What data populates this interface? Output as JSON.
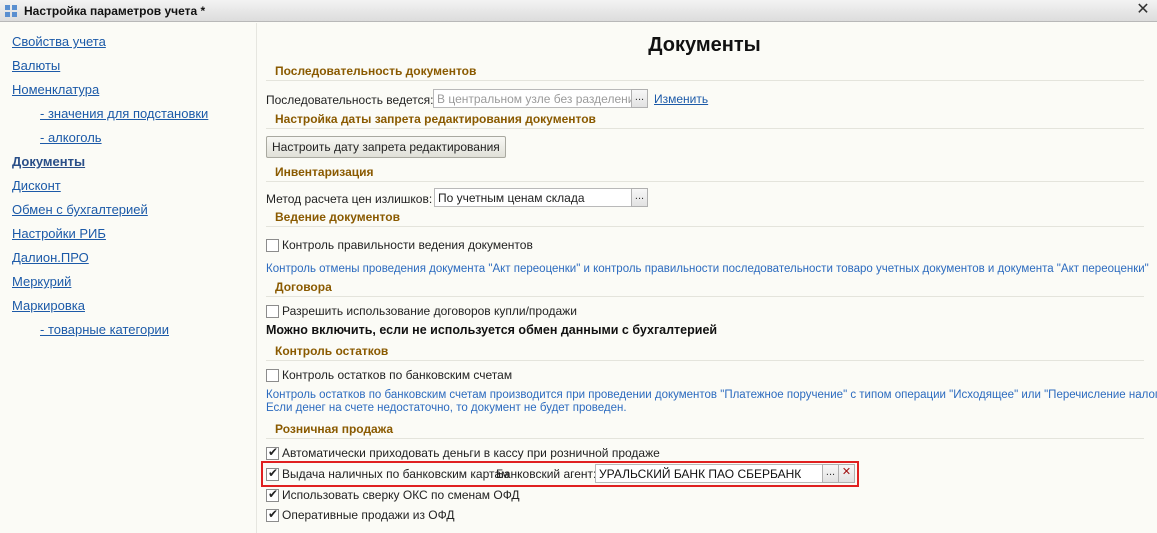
{
  "window": {
    "title": "Настройка параметров учета *",
    "close_glyph": "✕"
  },
  "nav": {
    "items": [
      {
        "label": "Свойства учета"
      },
      {
        "label": "Валюты"
      },
      {
        "label": "Номенклатура"
      },
      {
        "label": "- значения для подстановки"
      },
      {
        "label": "- алкоголь"
      },
      {
        "label": "Документы"
      },
      {
        "label": "Дисконт"
      },
      {
        "label": "Обмен с бухгалтерией"
      },
      {
        "label": "Настройки РИБ"
      },
      {
        "label": "Далион.ПРО"
      },
      {
        "label": "Меркурий"
      },
      {
        "label": "Маркировка"
      },
      {
        "label": "- товарные категории"
      }
    ],
    "active_index": 5
  },
  "main": {
    "title": "Документы",
    "sections": {
      "sequence": {
        "header": "Последовательность документов",
        "label": "Последовательность ведется:",
        "field_value": "В центральном узле без разделения по",
        "select_glyph": "...",
        "change_link": "Изменить"
      },
      "lock_date": {
        "header": "Настройка даты запрета редактирования документов",
        "button": "Настроить дату запрета редактирования"
      },
      "inventory": {
        "header": "Инвентаризация",
        "label": "Метод расчета цен излишков:",
        "field_value": "По учетным ценам склада",
        "select_glyph": "..."
      },
      "doc_keeping": {
        "header": "Ведение документов",
        "check_label": "Контроль правильности ведения документов",
        "checked": false,
        "note": "Контроль отмены проведения документа \"Акт переоценки\" и контроль правильности последовательности товаро учетных документов и документа \"Акт переоценки\""
      },
      "contracts": {
        "header": "Договора",
        "check_label": "Разрешить использование договоров купли/продажи",
        "checked": false,
        "note": "Можно включить, если не используется обмен данными с бухгалтерией"
      },
      "balance": {
        "header": "Контроль остатков",
        "check_label": "Контроль остатков по банковским счетам",
        "checked": false,
        "note_line1": "Контроль остатков по банковским счетам производится при проведении документов \"Платежное поручение\" с типом операции \"Исходящее\" или \"Перечисление налога\".",
        "note_line2": "Если денег на счете недостаточно, то документ не будет проведен."
      },
      "retail": {
        "header": "Розничная продажа",
        "auto_cash": {
          "label": "Автоматически приходовать деньги в кассу при розничной продаже",
          "checked": true
        },
        "cash_out": {
          "label": "Выдача наличных по банковским картам",
          "checked": true
        },
        "bank_agent_label": "Банковский агент:",
        "bank_agent_value": "УРАЛЬСКИЙ БАНК ПАО СБЕРБАНК",
        "select_glyph": "...",
        "clear_glyph": "✕",
        "oks": {
          "label": "Использовать сверку ОКС по сменам ОФД",
          "checked": true
        },
        "ofd": {
          "label": "Оперативные продажи из ОФД",
          "checked": true
        }
      }
    }
  },
  "colors": {
    "section_header": "#8a5a00",
    "link": "#1c5aa8",
    "note": "#2c6bbf",
    "highlight": "#e02020"
  }
}
